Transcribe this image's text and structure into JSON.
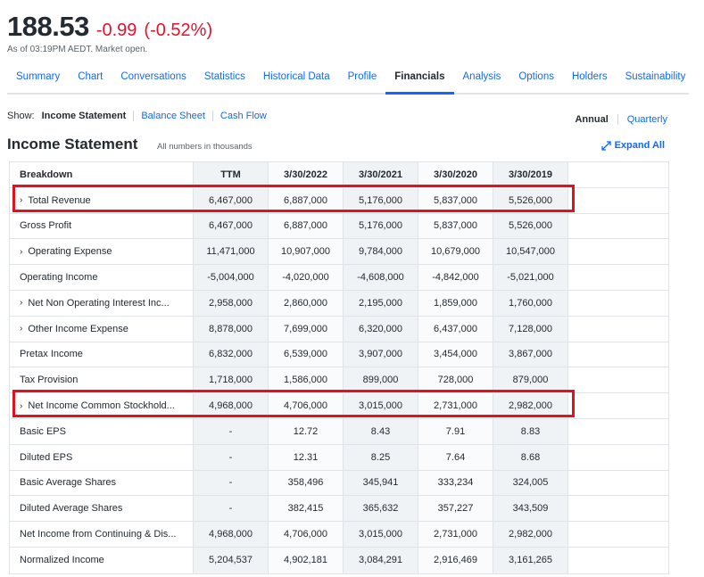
{
  "quote": {
    "price": "188.53",
    "change": "-0.99",
    "change_pct": "(-0.52%)",
    "as_of": "As of 03:19PM AEDT. Market open."
  },
  "tabs": [
    "Summary",
    "Chart",
    "Conversations",
    "Statistics",
    "Historical Data",
    "Profile",
    "Financials",
    "Analysis",
    "Options",
    "Holders",
    "Sustainability"
  ],
  "active_tab": "Financials",
  "show": {
    "label": "Show:",
    "options": [
      "Income Statement",
      "Balance Sheet",
      "Cash Flow"
    ]
  },
  "period": {
    "annual": "Annual",
    "quarterly": "Quarterly"
  },
  "section_title": "Income Statement",
  "units_note": "All numbers in thousands",
  "expand_all": "Expand All",
  "table": {
    "headers": [
      "Breakdown",
      "TTM",
      "3/30/2022",
      "3/30/2021",
      "3/30/2020",
      "3/30/2019"
    ],
    "rows": [
      {
        "label": "Total Revenue",
        "expandable": true,
        "values": [
          "6,467,000",
          "6,887,000",
          "5,176,000",
          "5,837,000",
          "5,526,000"
        ]
      },
      {
        "label": "Gross Profit",
        "expandable": false,
        "values": [
          "6,467,000",
          "6,887,000",
          "5,176,000",
          "5,837,000",
          "5,526,000"
        ]
      },
      {
        "label": "Operating Expense",
        "expandable": true,
        "values": [
          "11,471,000",
          "10,907,000",
          "9,784,000",
          "10,679,000",
          "10,547,000"
        ]
      },
      {
        "label": "Operating Income",
        "expandable": false,
        "values": [
          "-5,004,000",
          "-4,020,000",
          "-4,608,000",
          "-4,842,000",
          "-5,021,000"
        ]
      },
      {
        "label": "Net Non Operating Interest Inc...",
        "expandable": true,
        "values": [
          "2,958,000",
          "2,860,000",
          "2,195,000",
          "1,859,000",
          "1,760,000"
        ]
      },
      {
        "label": "Other Income Expense",
        "expandable": true,
        "values": [
          "8,878,000",
          "7,699,000",
          "6,320,000",
          "6,437,000",
          "7,128,000"
        ]
      },
      {
        "label": "Pretax Income",
        "expandable": false,
        "values": [
          "6,832,000",
          "6,539,000",
          "3,907,000",
          "3,454,000",
          "3,867,000"
        ]
      },
      {
        "label": "Tax Provision",
        "expandable": false,
        "values": [
          "1,718,000",
          "1,586,000",
          "899,000",
          "728,000",
          "879,000"
        ]
      },
      {
        "label": "Net Income Common Stockhold...",
        "expandable": true,
        "values": [
          "4,968,000",
          "4,706,000",
          "3,015,000",
          "2,731,000",
          "2,982,000"
        ]
      },
      {
        "label": "Basic EPS",
        "expandable": false,
        "values": [
          "-",
          "12.72",
          "8.43",
          "7.91",
          "8.83"
        ]
      },
      {
        "label": "Diluted EPS",
        "expandable": false,
        "values": [
          "-",
          "12.31",
          "8.25",
          "7.64",
          "8.68"
        ]
      },
      {
        "label": "Basic Average Shares",
        "expandable": false,
        "values": [
          "-",
          "358,496",
          "345,941",
          "333,234",
          "324,005"
        ]
      },
      {
        "label": "Diluted Average Shares",
        "expandable": false,
        "values": [
          "-",
          "382,415",
          "365,632",
          "357,227",
          "343,509"
        ]
      },
      {
        "label": "Net Income from Continuing & Dis...",
        "expandable": false,
        "values": [
          "4,968,000",
          "4,706,000",
          "3,015,000",
          "2,731,000",
          "2,982,000"
        ]
      },
      {
        "label": "Normalized Income",
        "expandable": false,
        "values": [
          "5,204,537",
          "4,902,181",
          "3,084,291",
          "2,916,469",
          "3,161,265"
        ]
      }
    ]
  },
  "colors": {
    "accent": "#0f69ff",
    "negative": "#eb0f29",
    "highlight": "#e0121f"
  }
}
